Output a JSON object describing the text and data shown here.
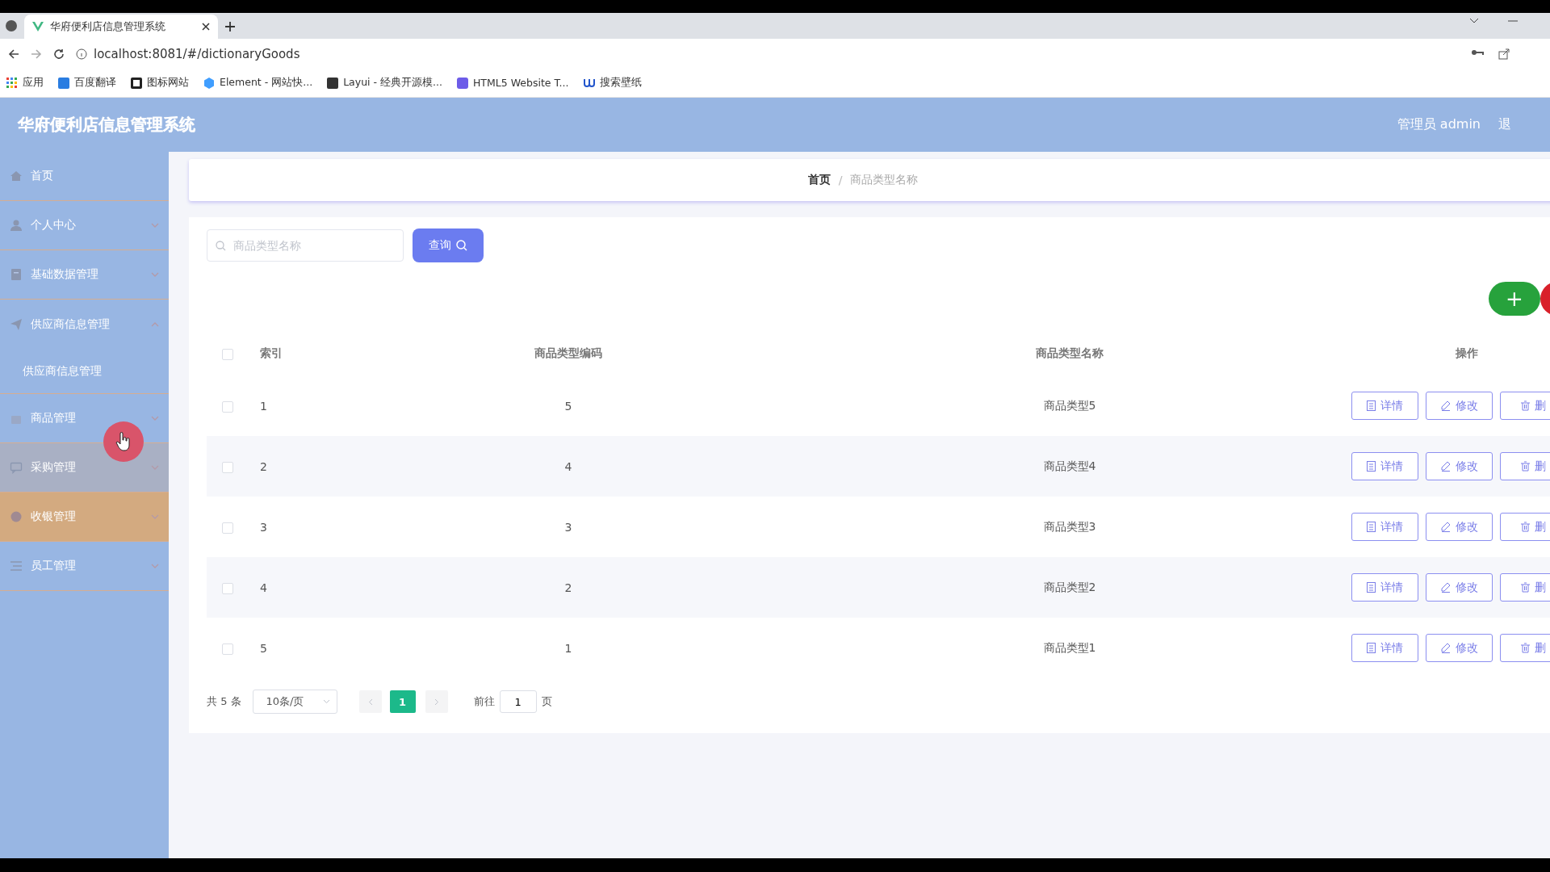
{
  "browser": {
    "tab_title": "华府便利店信息管理系统",
    "url": "localhost:8081/#/dictionaryGoods",
    "bookmarks": [
      {
        "label": "应用"
      },
      {
        "label": "百度翻译"
      },
      {
        "label": "图标网站"
      },
      {
        "label": "Element - 网站快..."
      },
      {
        "label": "Layui - 经典开源模..."
      },
      {
        "label": "HTML5 Website T..."
      },
      {
        "label": "搜索壁纸"
      }
    ]
  },
  "header": {
    "title": "华府便利店信息管理系统",
    "user": "管理员 admin",
    "logout": "退"
  },
  "sidebar": {
    "items": [
      {
        "label": "首页",
        "selected": false,
        "hovered": false
      },
      {
        "label": "个人中心",
        "expanded": false,
        "selected": false,
        "hovered": false
      },
      {
        "label": "基础数据管理",
        "expanded": false,
        "selected": false,
        "hovered": false
      },
      {
        "label": "供应商信息管理",
        "expanded": true,
        "selected": false,
        "hovered": false,
        "children": [
          {
            "label": "供应商信息管理"
          }
        ]
      },
      {
        "label": "商品管理",
        "expanded": false,
        "selected": false,
        "hovered": false
      },
      {
        "label": "采购管理",
        "expanded": false,
        "selected": false,
        "hovered": true
      },
      {
        "label": "收银管理",
        "expanded": false,
        "selected": true,
        "hovered": false
      },
      {
        "label": "员工管理",
        "expanded": false,
        "selected": false,
        "hovered": false
      }
    ]
  },
  "breadcrumb": [
    {
      "label": "首页"
    },
    {
      "label": "商品类型名称"
    }
  ],
  "breadcrumb_separator": "/",
  "search": {
    "placeholder": "商品类型名称",
    "button": "查询"
  },
  "add_button": "+",
  "table": {
    "header_checked": false,
    "columns": [
      "索引",
      "商品类型编码",
      "商品类型名称",
      "操作"
    ],
    "rows": [
      {
        "checked": false,
        "cells": [
          "1",
          "5",
          "商品类型5"
        ],
        "actions": [
          "详情",
          "修改",
          "删"
        ]
      },
      {
        "checked": false,
        "cells": [
          "2",
          "4",
          "商品类型4"
        ],
        "actions": [
          "详情",
          "修改",
          "删"
        ]
      },
      {
        "checked": false,
        "cells": [
          "3",
          "3",
          "商品类型3"
        ],
        "actions": [
          "详情",
          "修改",
          "删"
        ]
      },
      {
        "checked": false,
        "cells": [
          "4",
          "2",
          "商品类型2"
        ],
        "actions": [
          "详情",
          "修改",
          "删"
        ]
      },
      {
        "checked": false,
        "cells": [
          "5",
          "1",
          "商品类型1"
        ],
        "actions": [
          "详情",
          "修改",
          "删"
        ]
      }
    ]
  },
  "pagination": {
    "total": "共 5 条",
    "page_size": "10条/页",
    "pages": [
      {
        "label": "1",
        "selected": true
      }
    ],
    "goto_label": "前往",
    "goto_value": "1",
    "goto_suffix": "页"
  }
}
